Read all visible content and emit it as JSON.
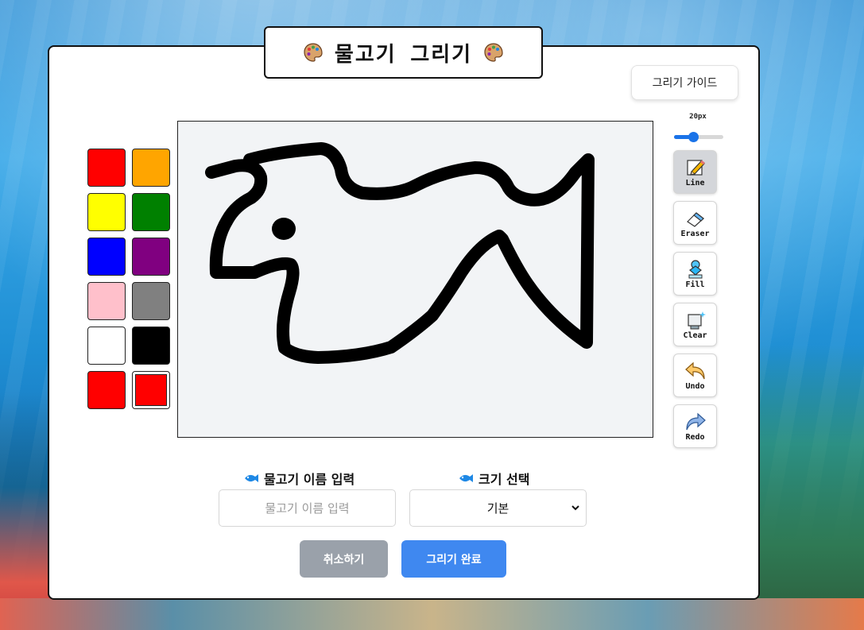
{
  "header": {
    "title": "물고기 그리기"
  },
  "toolbar": {
    "guide_label": "그리기 가이드"
  },
  "palette": {
    "colors": [
      "#ff0000",
      "#ffa500",
      "#ffff00",
      "#008000",
      "#0000ff",
      "#800080",
      "#ffc0cb",
      "#808080",
      "#ffffff",
      "#000000",
      "#ff0000",
      "#ff0000"
    ],
    "selected_color": "#ff0000"
  },
  "brush": {
    "size_label": "20px",
    "value": 20,
    "min": 1,
    "max": 50
  },
  "tools": [
    {
      "label": "Line",
      "icon": "pencil-icon",
      "active": true
    },
    {
      "label": "Eraser",
      "icon": "eraser-icon",
      "active": false
    },
    {
      "label": "Fill",
      "icon": "fill-bucket-icon",
      "active": false
    },
    {
      "label": "Clear",
      "icon": "clear-icon",
      "active": false
    },
    {
      "label": "Undo",
      "icon": "undo-icon",
      "active": false
    },
    {
      "label": "Redo",
      "icon": "redo-icon",
      "active": false
    }
  ],
  "form": {
    "name_label": "물고기 이름 입력",
    "name_placeholder": "물고기 이름 입력",
    "name_value": "",
    "size_label": "크기 선택",
    "size_selected": "기본"
  },
  "actions": {
    "cancel_label": "취소하기",
    "done_label": "그리기 완료"
  },
  "colors": {
    "accent": "#3f88f0",
    "cancel": "#9aa1aa",
    "canvas_bg": "#f2f4f6"
  }
}
